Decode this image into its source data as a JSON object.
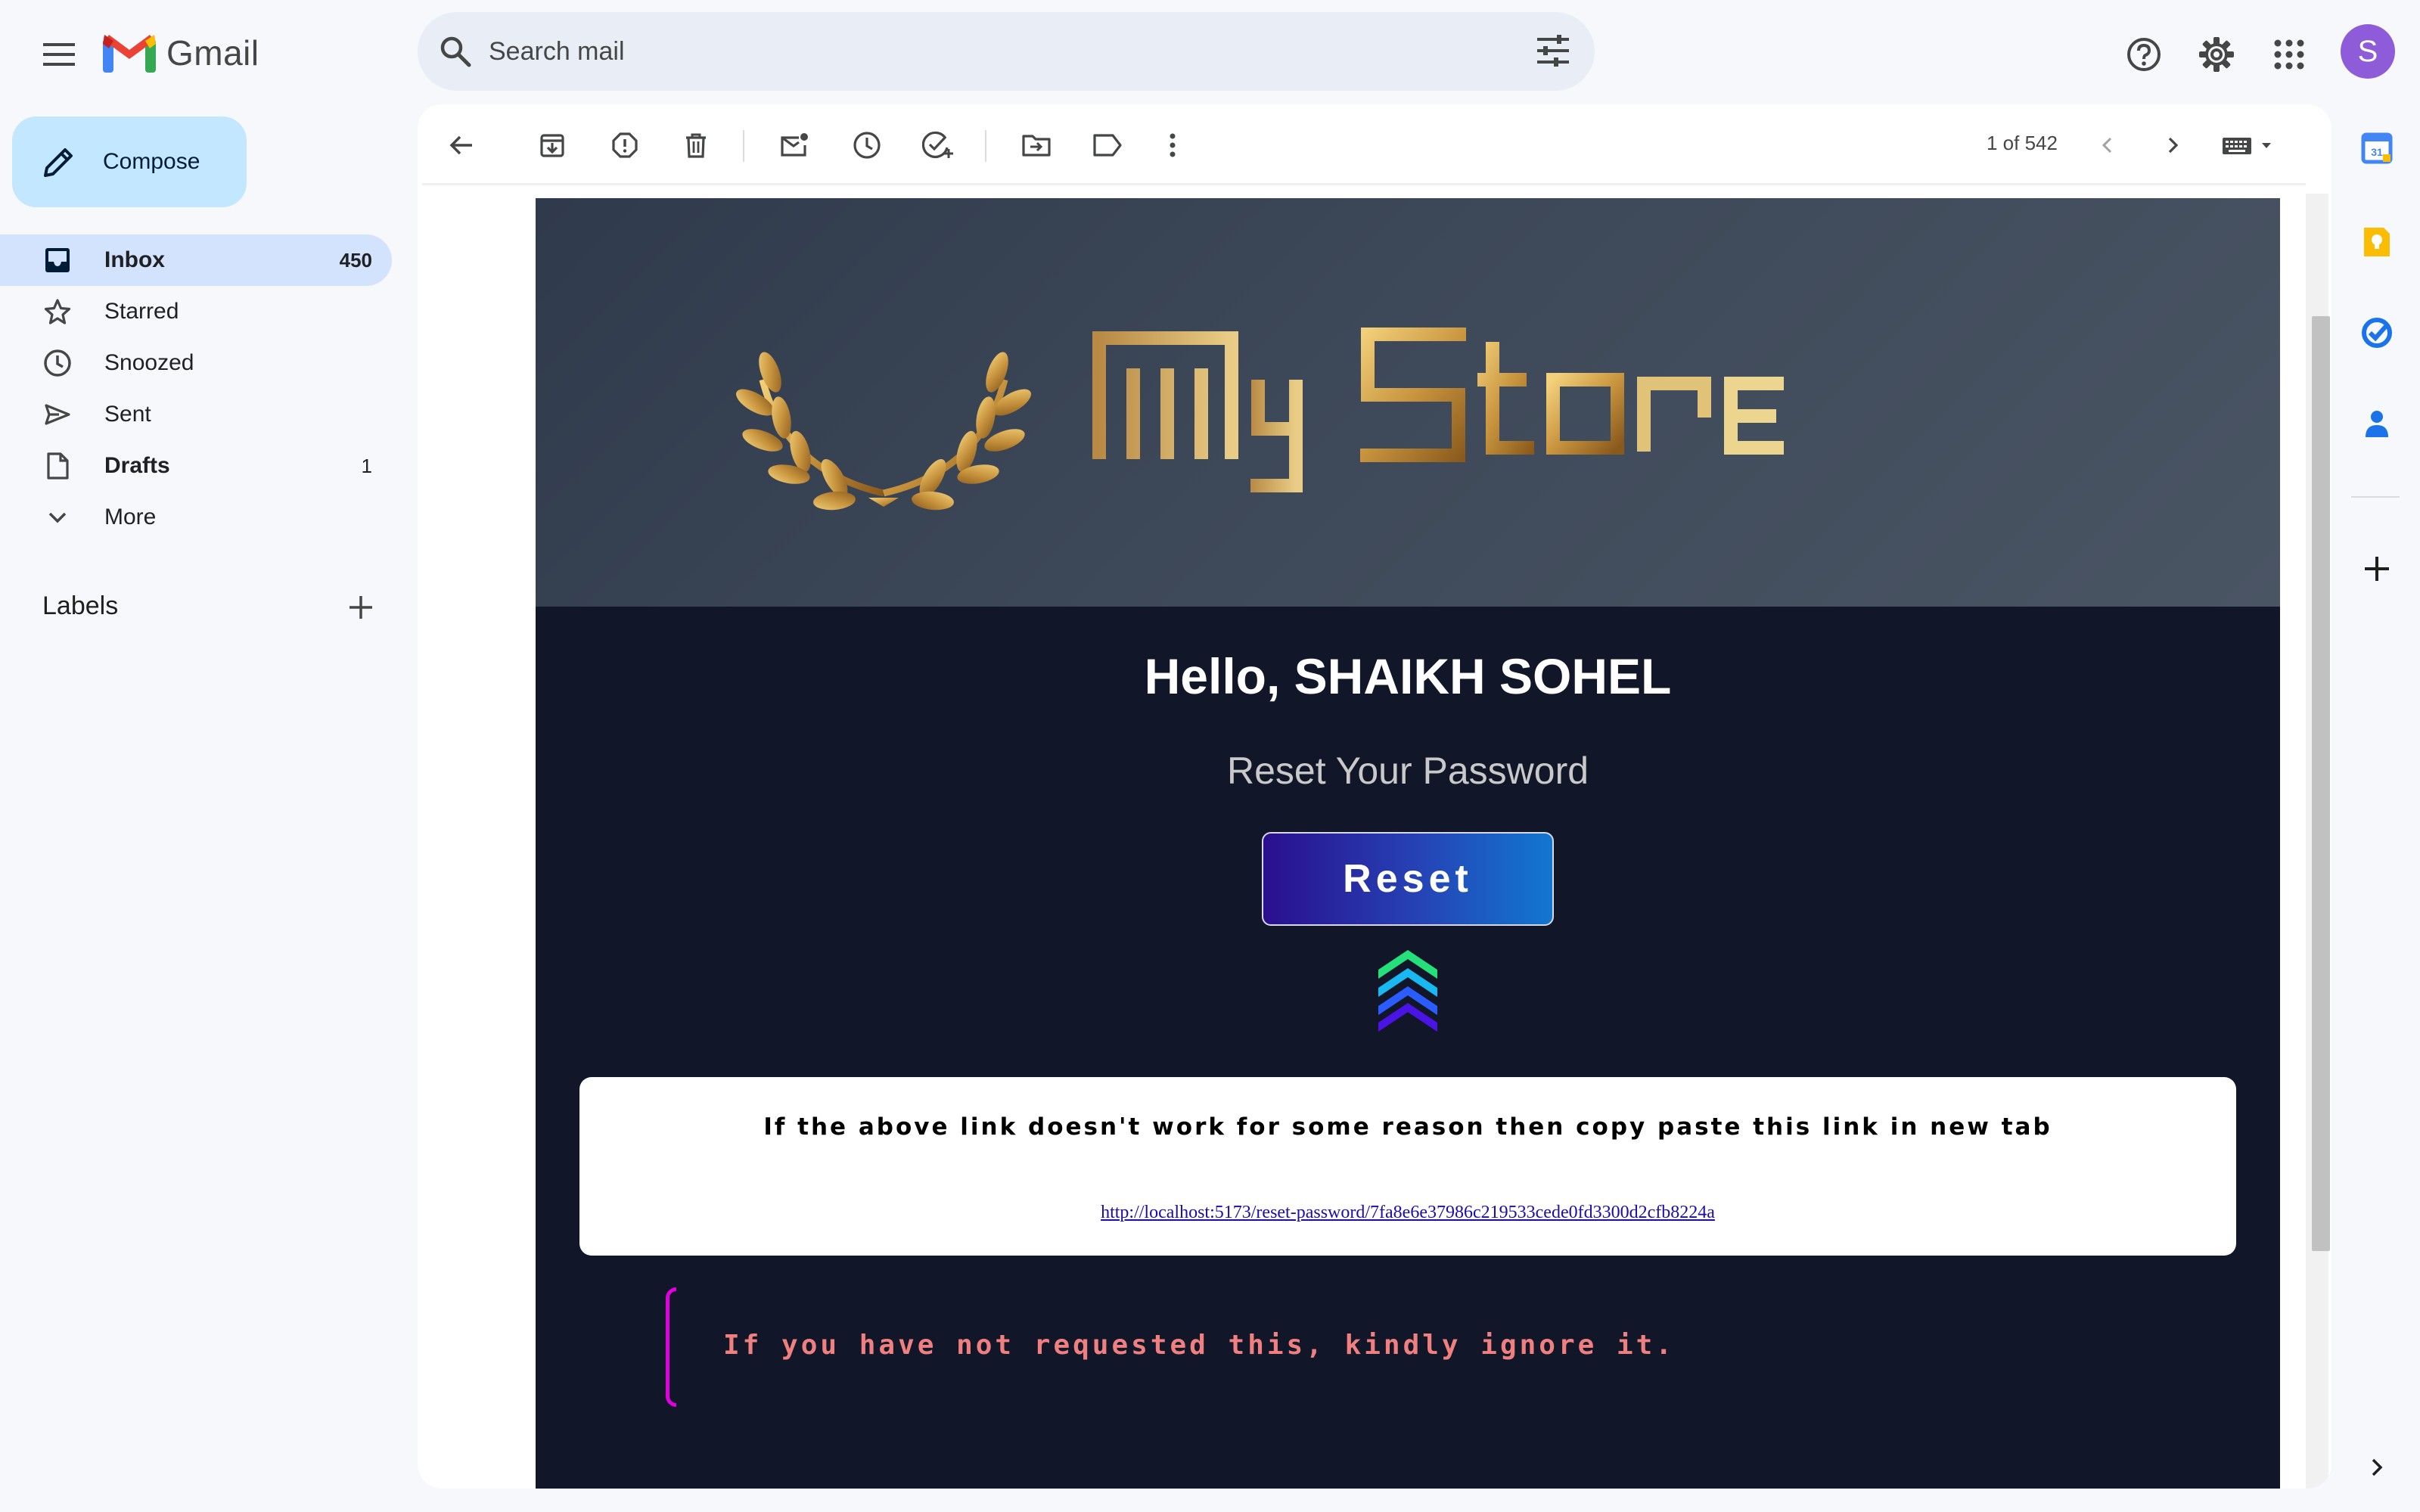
{
  "app": {
    "name": "Gmail",
    "account_initial": "S",
    "brand_color": "#ea4335"
  },
  "search": {
    "placeholder": "Search mail"
  },
  "compose": {
    "label": "Compose"
  },
  "nav": {
    "items": [
      {
        "label": "Inbox",
        "count": "450",
        "icon": "inbox-icon"
      },
      {
        "label": "Starred",
        "count": "",
        "icon": "star-icon"
      },
      {
        "label": "Snoozed",
        "count": "",
        "icon": "clock-icon"
      },
      {
        "label": "Sent",
        "count": "",
        "icon": "send-icon"
      },
      {
        "label": "Drafts",
        "count": "1",
        "icon": "draft-icon"
      },
      {
        "label": "More",
        "count": "",
        "icon": "chevron-down-icon"
      }
    ],
    "labels_title": "Labels"
  },
  "toolbar": {
    "icons": [
      "back-arrow-icon",
      "archive-icon",
      "report-spam-icon",
      "delete-icon",
      "mark-unread-icon",
      "snooze-icon",
      "add-to-tasks-icon",
      "move-to-icon",
      "label-icon",
      "more-vert-icon"
    ],
    "pager": "1 of 542"
  },
  "email": {
    "brand_text": "My Store",
    "greeting": "Hello, SHAIKH SOHEL",
    "subtitle": "Reset Your Password",
    "button_label": "Reset",
    "fallback_note": "If the above link doesn't work for some reason then copy paste this link in new tab",
    "reset_link": "http://localhost:5173/reset-password/7fa8e6e37986c219533cede0fd3300d2cfb8224a",
    "ignore_note": "If you have not requested this, kindly ignore it.",
    "colors": {
      "background": "#111729",
      "button_start": "#2a0f8e",
      "button_end": "#1277d0",
      "gold": "#c9a45a",
      "ignore_text": "#f07f7f",
      "quote_bar": "#e000e0"
    }
  },
  "side_panel": {
    "apps": [
      "calendar-icon",
      "keep-icon",
      "tasks-icon",
      "contacts-icon",
      "add-app-icon"
    ],
    "calendar_day": "31"
  }
}
